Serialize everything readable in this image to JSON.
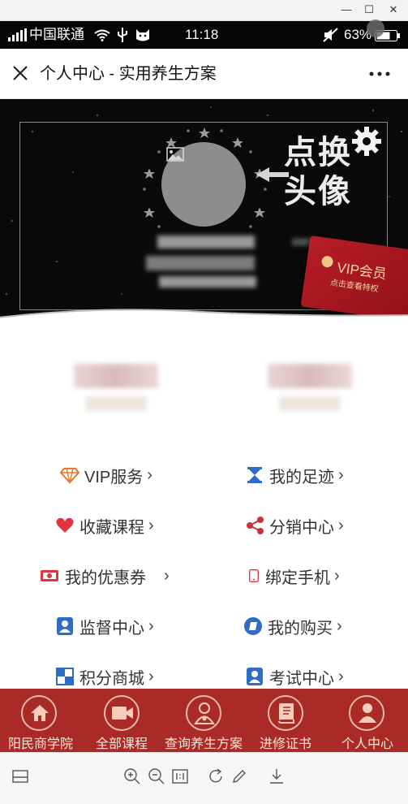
{
  "window": {
    "minimize": "—",
    "maximize": "☐",
    "close": "✕"
  },
  "status": {
    "carrier": "中国联通",
    "time": "11:18",
    "battery": "63%"
  },
  "titlebar": {
    "title": "个人中心 - 实用养生方案"
  },
  "banner": {
    "change_avatar": "点换\n头像",
    "vip_title": "VIP会员",
    "vip_sub": "点击查看特权"
  },
  "menu": [
    {
      "label": "VIP服务",
      "icon": "diamond-icon",
      "color": "#e8752a"
    },
    {
      "label": "我的足迹",
      "icon": "hourglass-icon",
      "color": "#2f6cc4"
    },
    {
      "label": "收藏课程",
      "icon": "heart-icon",
      "color": "#e0353f"
    },
    {
      "label": "分销中心",
      "icon": "share-icon",
      "color": "#c8323a"
    },
    {
      "label": "我的优惠券",
      "icon": "coupon-icon",
      "color": "#e0353f"
    },
    {
      "label": "绑定手机",
      "icon": "phone-icon",
      "color": "#e0353f"
    },
    {
      "label": "监督中心",
      "icon": "person-card-icon",
      "color": "#2f6cc4"
    },
    {
      "label": "我的购买",
      "icon": "purchase-icon",
      "color": "#2f6cc4"
    },
    {
      "label": "积分商城",
      "icon": "points-icon",
      "color": "#2f6cc4"
    },
    {
      "label": "考试中心",
      "icon": "exam-icon",
      "color": "#2f6cc4"
    }
  ],
  "nav": [
    {
      "label": "阳民商学院",
      "icon": "home-icon"
    },
    {
      "label": "全部课程",
      "icon": "video-icon"
    },
    {
      "label": "查询养生方案",
      "icon": "doctor-icon"
    },
    {
      "label": "进修证书",
      "icon": "book-icon"
    },
    {
      "label": "个人中心",
      "icon": "user-icon"
    }
  ],
  "colors": {
    "brand_red": "#a92a27",
    "menu_text": "#333333"
  }
}
